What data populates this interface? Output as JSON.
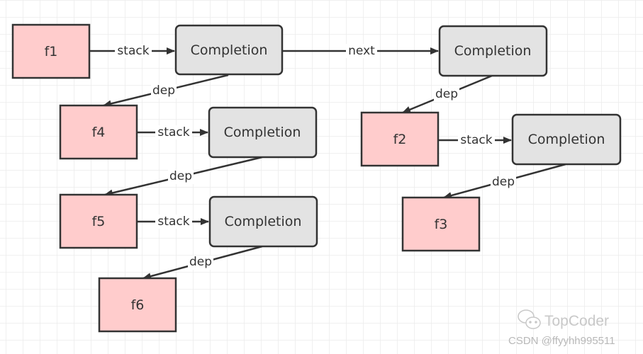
{
  "colors": {
    "future_fill": "#ffcccc",
    "completion_fill": "#e3e3e3",
    "stroke": "#333333",
    "grid": "#ececec"
  },
  "nodes": {
    "f1": "f1",
    "f2": "f2",
    "f3": "f3",
    "f4": "f4",
    "f5": "f5",
    "f6": "f6",
    "c1": "Completion",
    "c2": "Completion",
    "c3": "Completion",
    "c4": "Completion",
    "c5": "Completion"
  },
  "edges": {
    "f1_c1": "stack",
    "c1_c2": "next",
    "c1_f4": "dep",
    "f4_c3": "stack",
    "c3_f5": "dep",
    "f5_c5": "stack",
    "c5_f6": "dep",
    "c2_f2": "dep",
    "f2_c4": "stack",
    "c4_f3": "dep"
  },
  "watermark": {
    "brand": "TopCoder",
    "credit": "CSDN @ffyyhh995511",
    "brand_icon": "wechat-icon"
  }
}
